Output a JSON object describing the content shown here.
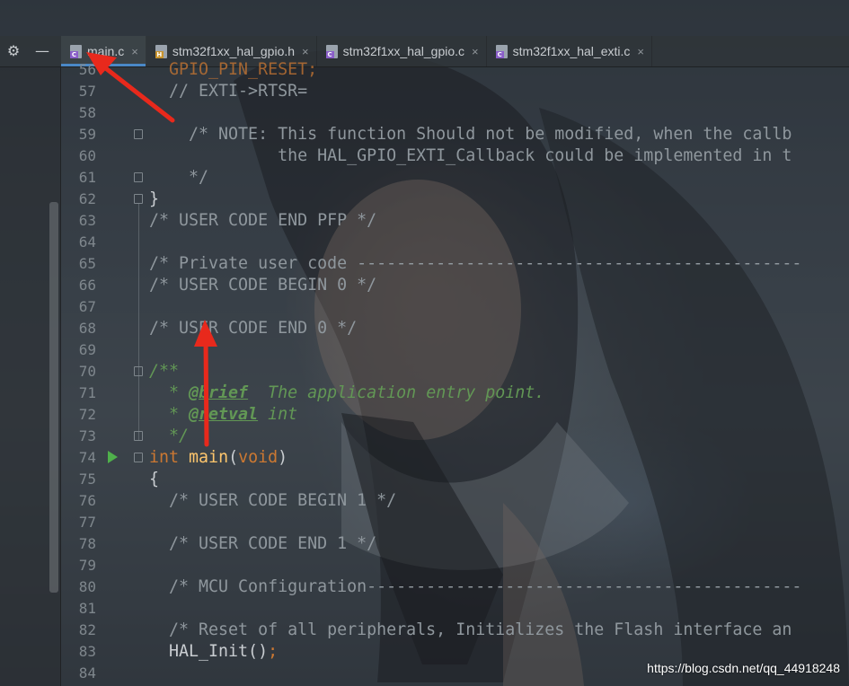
{
  "toolbar": {
    "settings_icon": "gear-icon",
    "minimize_icon": "minus-icon"
  },
  "tabs": [
    {
      "label": "main.c",
      "type": "C",
      "active": true
    },
    {
      "label": "stm32f1xx_hal_gpio.h",
      "type": "H",
      "active": false
    },
    {
      "label": "stm32f1xx_hal_gpio.c",
      "type": "C",
      "active": false
    },
    {
      "label": "stm32f1xx_hal_exti.c",
      "type": "C",
      "active": false
    }
  ],
  "tab_close_glyph": "×",
  "line_numbers": [
    "56",
    "57",
    "58",
    "59",
    "60",
    "61",
    "62",
    "63",
    "64",
    "65",
    "66",
    "67",
    "68",
    "69",
    "70",
    "71",
    "72",
    "73",
    "74",
    "75",
    "76",
    "77",
    "78",
    "79",
    "80",
    "81",
    "82",
    "83",
    "84"
  ],
  "code": {
    "l56": "  GPIO_PIN_RESET;",
    "l57": "  // EXTI->RTSR=",
    "l59": "    /* NOTE: This function Should not be modified, when the callb",
    "l60": "             the HAL_GPIO_EXTI_Callback could be implemented in t",
    "l61": "    */",
    "l62": "}",
    "l63": "/* USER CODE END PFP */",
    "l65": "/* Private user code ---------------------------------------------",
    "l66": "/* USER CODE BEGIN 0 */",
    "l68": "/* USER CODE END 0 */",
    "l70": "/**",
    "l71_star": "  * ",
    "l71_tag": "@brief",
    "l71_text": "  The application entry point.",
    "l72_star": "  * ",
    "l72_tag": "@retval",
    "l72_text": " int",
    "l73": "  */",
    "l74_kw": "int",
    "l74_fn": "main",
    "l74_open": "(",
    "l74_void": "void",
    "l74_close": ")",
    "l75": "{",
    "l76": "  /* USER CODE BEGIN 1 */",
    "l78": "  /* USER CODE END 1 */",
    "l80": "  /* MCU Configuration--------------------------------------------",
    "l82": "  /* Reset of all peripherals, Initializes the Flash interface an",
    "l83_call": "  HAL_Init()",
    "l83_semi": ";"
  },
  "watermark": "https://blog.csdn.net/qq_44918248",
  "colors": {
    "keyword": "#cc7832",
    "function": "#ffc66d",
    "comment": "#8f979d",
    "doc_comment": "#629755",
    "annotation_arrow": "#e8291c",
    "active_tab_underline": "#4a88c7"
  }
}
